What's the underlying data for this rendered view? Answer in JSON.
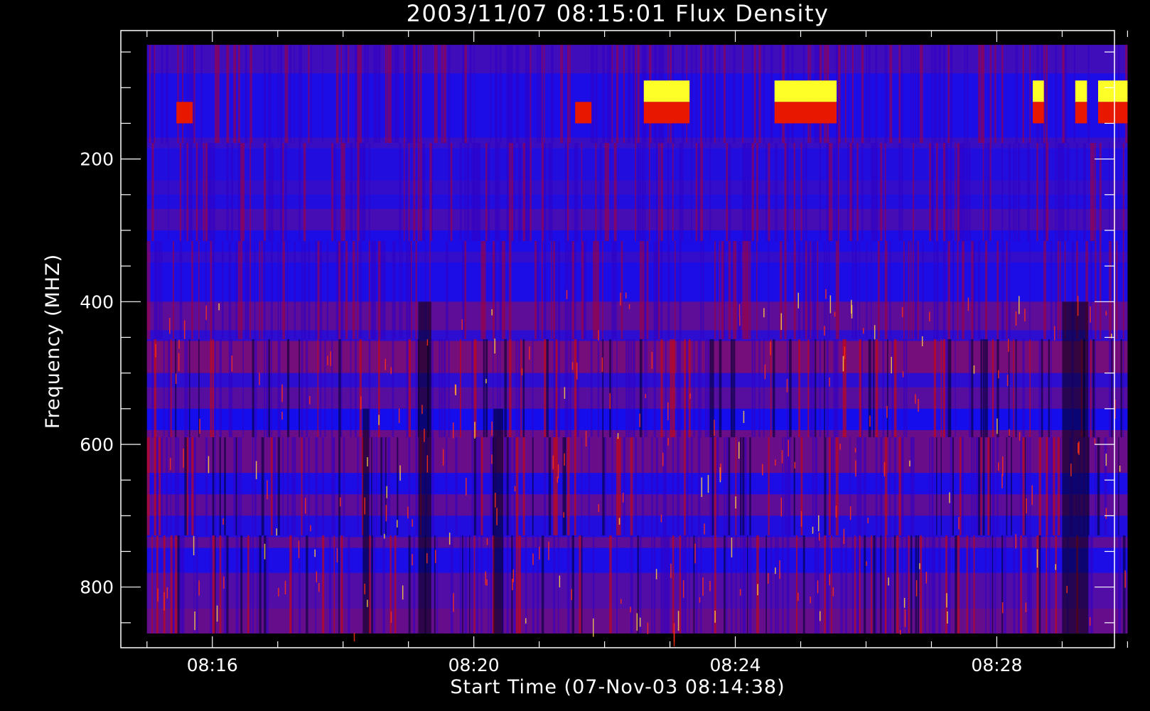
{
  "chart_data": {
    "type": "heatmap",
    "title": "2003/11/07 08:15:01 Flux Density",
    "xlabel": "Start Time (07-Nov-03 08:14:38)",
    "ylabel": "Frequency (MHZ)",
    "x_tick_labels": [
      "08:16",
      "08:20",
      "08:24",
      "08:28"
    ],
    "x_ticks": [
      16,
      20,
      24,
      28
    ],
    "x_range_minutes": [
      14.6,
      29.8
    ],
    "x_data_minutes": [
      15.0,
      30.0
    ],
    "y_tick_labels": [
      "200",
      "400",
      "600",
      "800"
    ],
    "y_ticks": [
      200,
      400,
      600,
      800
    ],
    "y_range": [
      20,
      885
    ],
    "y_data": [
      40,
      865
    ],
    "y_reversed": true,
    "grid": false,
    "colormap": [
      "#000000",
      "#0000ff",
      "#c00000",
      "#ffff00"
    ],
    "colors": {
      "background": "#000000",
      "axes": "#ffffff",
      "base": "#1e1ef0"
    },
    "frequency_bands": [
      {
        "from": 40,
        "to": 80,
        "level": 0.42
      },
      {
        "from": 80,
        "to": 170,
        "level": 0.3
      },
      {
        "from": 170,
        "to": 185,
        "level": 0.4
      },
      {
        "from": 185,
        "to": 230,
        "level": 0.32
      },
      {
        "from": 230,
        "to": 250,
        "level": 0.38
      },
      {
        "from": 250,
        "to": 270,
        "level": 0.32
      },
      {
        "from": 270,
        "to": 300,
        "level": 0.44
      },
      {
        "from": 300,
        "to": 330,
        "level": 0.3
      },
      {
        "from": 330,
        "to": 345,
        "level": 0.38
      },
      {
        "from": 345,
        "to": 400,
        "level": 0.3
      },
      {
        "from": 400,
        "to": 440,
        "level": 0.52
      },
      {
        "from": 440,
        "to": 455,
        "level": 0.36
      },
      {
        "from": 455,
        "to": 500,
        "level": 0.6
      },
      {
        "from": 500,
        "to": 520,
        "level": 0.36
      },
      {
        "from": 520,
        "to": 550,
        "level": 0.5
      },
      {
        "from": 550,
        "to": 580,
        "level": 0.28
      },
      {
        "from": 580,
        "to": 640,
        "level": 0.56
      },
      {
        "from": 640,
        "to": 670,
        "level": 0.3
      },
      {
        "from": 670,
        "to": 700,
        "level": 0.52
      },
      {
        "from": 700,
        "to": 730,
        "level": 0.32
      },
      {
        "from": 730,
        "to": 745,
        "level": 0.52
      },
      {
        "from": 745,
        "to": 780,
        "level": 0.3
      },
      {
        "from": 780,
        "to": 830,
        "level": 0.48
      },
      {
        "from": 830,
        "to": 865,
        "level": 0.55
      }
    ],
    "bursts": [
      {
        "t0": 15.45,
        "t1": 15.7,
        "f0": 120,
        "f1": 150,
        "level": 0.75
      },
      {
        "t0": 21.55,
        "t1": 21.8,
        "f0": 120,
        "f1": 150,
        "level": 0.75
      },
      {
        "t0": 22.6,
        "t1": 23.3,
        "f0": 90,
        "f1": 120,
        "level": 1.0
      },
      {
        "t0": 22.6,
        "t1": 23.3,
        "f0": 120,
        "f1": 150,
        "level": 0.75
      },
      {
        "t0": 24.6,
        "t1": 25.55,
        "f0": 90,
        "f1": 120,
        "level": 1.0
      },
      {
        "t0": 24.6,
        "t1": 25.55,
        "f0": 120,
        "f1": 150,
        "level": 0.75
      },
      {
        "t0": 28.55,
        "t1": 28.72,
        "f0": 90,
        "f1": 120,
        "level": 1.0
      },
      {
        "t0": 28.55,
        "t1": 28.72,
        "f0": 120,
        "f1": 150,
        "level": 0.75
      },
      {
        "t0": 29.2,
        "t1": 29.38,
        "f0": 90,
        "f1": 120,
        "level": 1.0
      },
      {
        "t0": 29.2,
        "t1": 29.38,
        "f0": 120,
        "f1": 150,
        "level": 0.75
      },
      {
        "t0": 29.55,
        "t1": 30.0,
        "f0": 90,
        "f1": 120,
        "level": 1.0
      },
      {
        "t0": 29.55,
        "t1": 30.0,
        "f0": 120,
        "f1": 150,
        "level": 0.75
      }
    ],
    "quiet_columns": [
      {
        "t0": 18.3,
        "t1": 18.4,
        "from": 550,
        "to": 865
      },
      {
        "t0": 19.15,
        "t1": 19.35,
        "from": 400,
        "to": 865
      },
      {
        "t0": 20.3,
        "t1": 20.45,
        "from": 550,
        "to": 865
      },
      {
        "t0": 29.0,
        "t1": 29.4,
        "from": 400,
        "to": 865
      }
    ]
  }
}
